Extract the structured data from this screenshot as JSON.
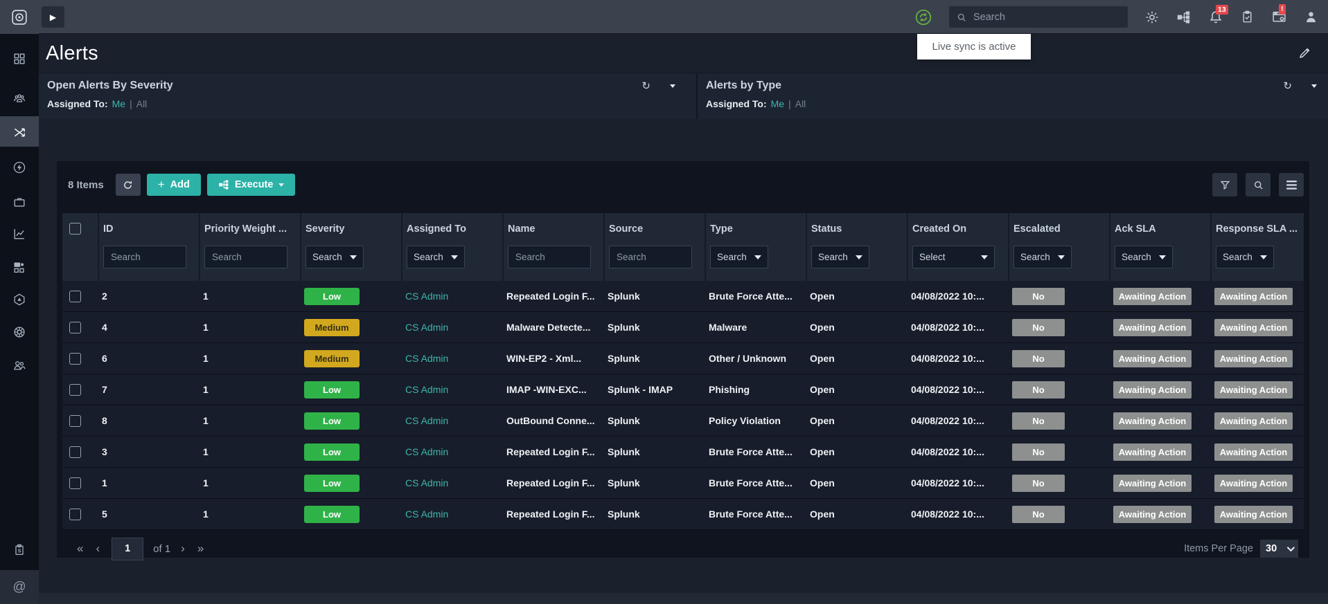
{
  "topbar": {
    "search_placeholder": "Search",
    "tooltip": "Live sync is active",
    "notifications_badge": "13",
    "alerts_badge": "!"
  },
  "page": {
    "title": "Alerts"
  },
  "widgets": [
    {
      "title": "Open Alerts By Severity",
      "assigned_to_label": "Assigned To:",
      "me_link": "Me",
      "separator": "|",
      "all_link": "All"
    },
    {
      "title": "Alerts by Type",
      "assigned_to_label": "Assigned To:",
      "me_link": "Me",
      "separator": "|",
      "all_link": "All"
    }
  ],
  "toolbar": {
    "item_count": "8 Items",
    "add_label": "Add",
    "execute_label": "Execute"
  },
  "table": {
    "columns": [
      {
        "key": "id",
        "label": "ID",
        "filter": "text",
        "placeholder": "Search"
      },
      {
        "key": "priority_weight",
        "label": "Priority Weight ...",
        "filter": "text",
        "placeholder": "Search"
      },
      {
        "key": "severity",
        "label": "Severity",
        "filter": "select",
        "placeholder": "Search"
      },
      {
        "key": "assigned_to",
        "label": "Assigned To",
        "filter": "select",
        "placeholder": "Search"
      },
      {
        "key": "name",
        "label": "Name",
        "filter": "text",
        "placeholder": "Search"
      },
      {
        "key": "source",
        "label": "Source",
        "filter": "text",
        "placeholder": "Search"
      },
      {
        "key": "type",
        "label": "Type",
        "filter": "select",
        "placeholder": "Search"
      },
      {
        "key": "status",
        "label": "Status",
        "filter": "select",
        "placeholder": "Search"
      },
      {
        "key": "created_on",
        "label": "Created On",
        "filter": "select",
        "placeholder": "Select",
        "wide": true
      },
      {
        "key": "escalated",
        "label": "Escalated",
        "filter": "select",
        "placeholder": "Search"
      },
      {
        "key": "ack_sla",
        "label": "Ack SLA",
        "filter": "select",
        "placeholder": "Search"
      },
      {
        "key": "response_sla",
        "label": "Response SLA ...",
        "filter": "select",
        "placeholder": "Search"
      }
    ],
    "rows": [
      {
        "id": "2",
        "priority_weight": "1",
        "severity": "Low",
        "assigned_to": "CS Admin",
        "name": "Repeated Login F...",
        "source": "Splunk",
        "type": "Brute Force Atte...",
        "status": "Open",
        "created_on": "04/08/2022 10:...",
        "escalated": "No",
        "ack_sla": "Awaiting Action",
        "response_sla": "Awaiting Action"
      },
      {
        "id": "4",
        "priority_weight": "1",
        "severity": "Medium",
        "assigned_to": "CS Admin",
        "name": "Malware Detecte...",
        "source": "Splunk",
        "type": "Malware",
        "status": "Open",
        "created_on": "04/08/2022 10:...",
        "escalated": "No",
        "ack_sla": "Awaiting Action",
        "response_sla": "Awaiting Action"
      },
      {
        "id": "6",
        "priority_weight": "1",
        "severity": "Medium",
        "assigned_to": "CS Admin",
        "name": "WIN-EP2 - Xml...",
        "source": "Splunk",
        "type": "Other / Unknown",
        "status": "Open",
        "created_on": "04/08/2022 10:...",
        "escalated": "No",
        "ack_sla": "Awaiting Action",
        "response_sla": "Awaiting Action"
      },
      {
        "id": "7",
        "priority_weight": "1",
        "severity": "Low",
        "assigned_to": "CS Admin",
        "name": "IMAP -WIN-EXC...",
        "source": "Splunk - IMAP",
        "type": "Phishing",
        "status": "Open",
        "created_on": "04/08/2022 10:...",
        "escalated": "No",
        "ack_sla": "Awaiting Action",
        "response_sla": "Awaiting Action"
      },
      {
        "id": "8",
        "priority_weight": "1",
        "severity": "Low",
        "assigned_to": "CS Admin",
        "name": "OutBound Conne...",
        "source": "Splunk",
        "type": "Policy Violation",
        "status": "Open",
        "created_on": "04/08/2022 10:...",
        "escalated": "No",
        "ack_sla": "Awaiting Action",
        "response_sla": "Awaiting Action"
      },
      {
        "id": "3",
        "priority_weight": "1",
        "severity": "Low",
        "assigned_to": "CS Admin",
        "name": "Repeated Login F...",
        "source": "Splunk",
        "type": "Brute Force Atte...",
        "status": "Open",
        "created_on": "04/08/2022 10:...",
        "escalated": "No",
        "ack_sla": "Awaiting Action",
        "response_sla": "Awaiting Action"
      },
      {
        "id": "1",
        "priority_weight": "1",
        "severity": "Low",
        "assigned_to": "CS Admin",
        "name": "Repeated Login F...",
        "source": "Splunk",
        "type": "Brute Force Atte...",
        "status": "Open",
        "created_on": "04/08/2022 10:...",
        "escalated": "No",
        "ack_sla": "Awaiting Action",
        "response_sla": "Awaiting Action"
      },
      {
        "id": "5",
        "priority_weight": "1",
        "severity": "Low",
        "assigned_to": "CS Admin",
        "name": "Repeated Login F...",
        "source": "Splunk",
        "type": "Brute Force Atte...",
        "status": "Open",
        "created_on": "04/08/2022 10:...",
        "escalated": "No",
        "ack_sla": "Awaiting Action",
        "response_sla": "Awaiting Action"
      }
    ]
  },
  "pagination": {
    "current_page": "1",
    "of_label": "of 1",
    "items_per_page_label": "Items Per Page",
    "items_per_page_value": "30"
  },
  "colors": {
    "accent_teal": "#2cb2a7",
    "severity_low": "#2fb348",
    "severity_medium": "#d2a81e",
    "badge_gray": "#8e9090",
    "alert_red": "#e5484d",
    "sync_green": "#67b643"
  }
}
